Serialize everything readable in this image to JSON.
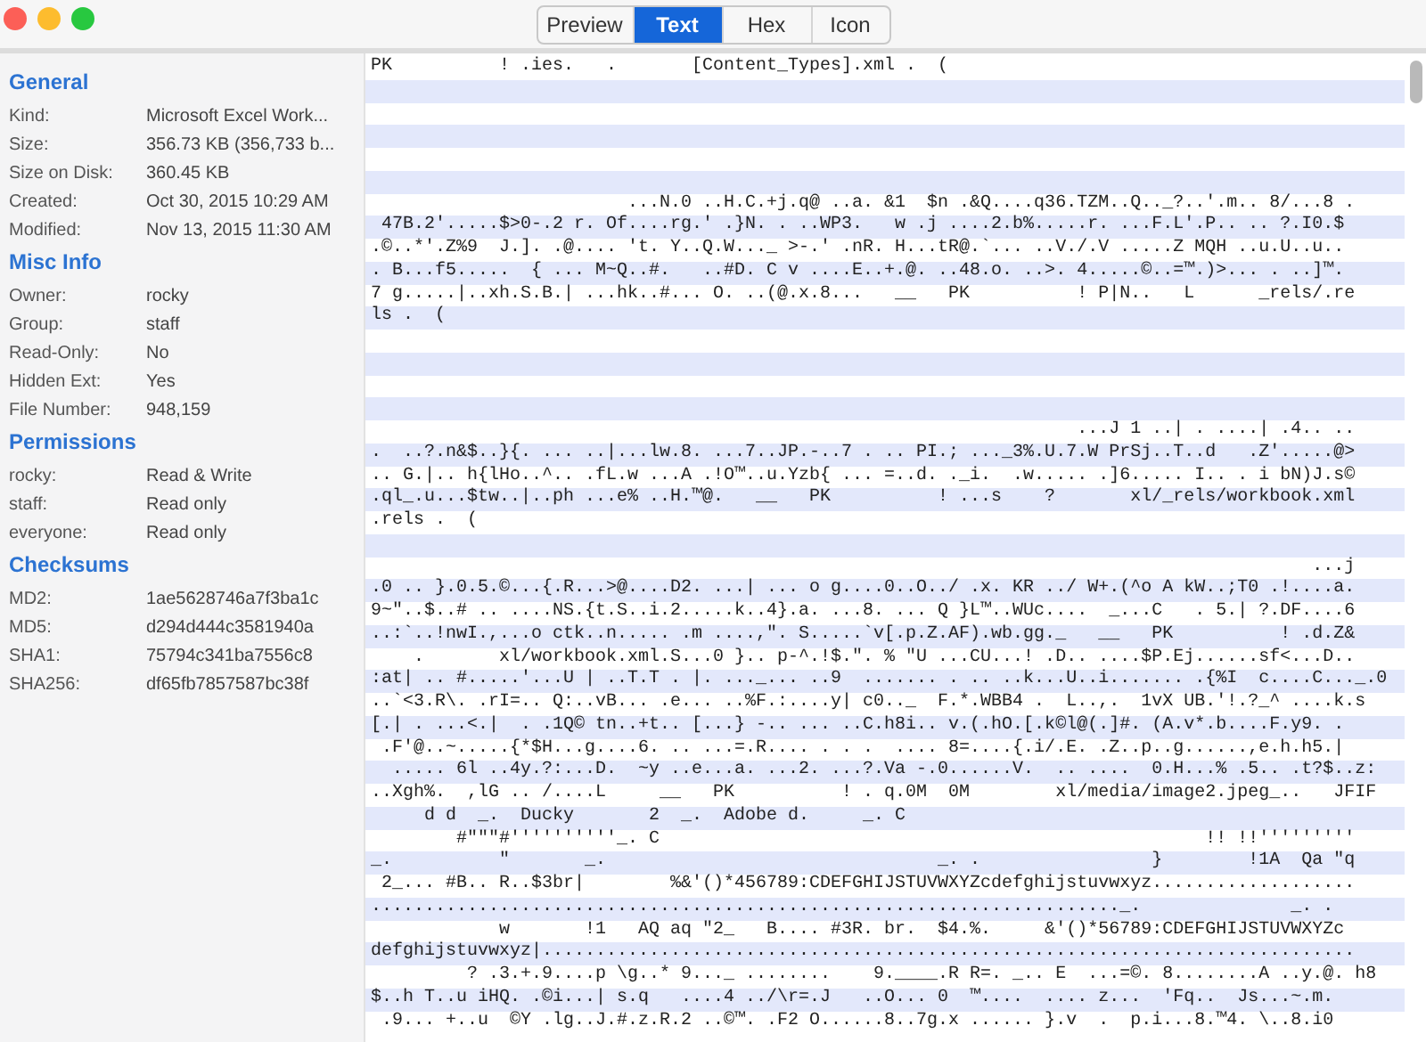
{
  "window": {
    "tabs": [
      {
        "label": "Preview",
        "selected": false
      },
      {
        "label": "Text",
        "selected": true
      },
      {
        "label": "Hex",
        "selected": false
      },
      {
        "label": "Icon",
        "selected": false
      }
    ]
  },
  "sidebar": {
    "sections": [
      {
        "title": "General",
        "rows": [
          {
            "label": "Kind:",
            "value": "Microsoft Excel Work..."
          },
          {
            "label": "Size:",
            "value": "356.73 KB (356,733 b..."
          },
          {
            "label": "Size on Disk:",
            "value": "360.45 KB"
          },
          {
            "label": "Created:",
            "value": "Oct 30, 2015 10:29 AM"
          },
          {
            "label": "Modified:",
            "value": "Nov 13, 2015 11:30 AM"
          }
        ]
      },
      {
        "title": "Misc Info",
        "rows": [
          {
            "label": "Owner:",
            "value": "rocky"
          },
          {
            "label": "Group:",
            "value": "staff"
          },
          {
            "label": "Read-Only:",
            "value": "No"
          },
          {
            "label": "Hidden Ext:",
            "value": "Yes"
          },
          {
            "label": "File Number:",
            "value": "948,159"
          }
        ]
      },
      {
        "title": "Permissions",
        "rows": [
          {
            "label": "rocky:",
            "value": "Read & Write"
          },
          {
            "label": "staff:",
            "value": "Read only"
          },
          {
            "label": "everyone:",
            "value": "Read only"
          }
        ]
      },
      {
        "title": "Checksums",
        "rows": [
          {
            "label": "MD2:",
            "value": "1ae5628746a7f3ba1c"
          },
          {
            "label": "MD5:",
            "value": "d294d444c3581940a"
          },
          {
            "label": "SHA1:",
            "value": "75794c341ba7556c8"
          },
          {
            "label": "SHA256:",
            "value": "df65fb7857587bc38f"
          }
        ]
      }
    ]
  },
  "text_view": {
    "lines": [
      {
        "kind": "text",
        "text": "PK          ! .ies.   .       [Content_Types].xml .  ("
      },
      {
        "kind": "blank"
      },
      {
        "kind": "blank"
      },
      {
        "kind": "blank"
      },
      {
        "kind": "blank"
      },
      {
        "kind": "blank"
      },
      {
        "kind": "text",
        "text": "                        ...N.0 ..H.C.+j.q@ ..a. &1  $n .&Q....q36.TZM..Q.._?..'.m.. 8/...8 ."
      },
      {
        "kind": "text",
        "text": " 47B.2'.....$>0-.2 r. Of....rg.' .}N. . ..WP3.   w .j ....2.b%.....r. ...F.L'.P.. .. ?.I0.$"
      },
      {
        "kind": "text",
        "text": ".©..*'.Z%9  J.]. .@.... 't. Y..Q.W..._ >-.' .nR. H...tR@.`... ..V./.V .....Z MQH ..u.U..u.."
      },
      {
        "kind": "text",
        "text": ". B...f5.....  { ... M~Q..#.   ..#D. C v ....E..+.@. ..48.o. ..>. 4.....©..=™.)>... . ..]™."
      },
      {
        "kind": "text",
        "text": "7 g.....|..xh.S.B.| ...hk..#... O. ..(@.x.8...   __   PK          ! P|N..   L      _rels/.re"
      },
      {
        "kind": "text",
        "text": "ls .  ("
      },
      {
        "kind": "blank"
      },
      {
        "kind": "blank"
      },
      {
        "kind": "blank"
      },
      {
        "kind": "blank"
      },
      {
        "kind": "text",
        "text": "                                                                  ...J 1 ..| . ....| .4.. .."
      },
      {
        "kind": "text",
        "text": ".  ..?.n&$..}{. ... ..|...lw.8. ...7..JP.-..7 . .. PI.; ..._3%.U.7.W PrSj..T..d   .Z'.....@>"
      },
      {
        "kind": "text",
        "text": ".. G.|.. h{lHo..^.. .fL.w ...A .!O™..u.Yzb{ ... =..d. ._i.  .w..... .]6..... I.. . i bN)J.s©"
      },
      {
        "kind": "text",
        "text": ".ql_.u...$tw..|..ph ...e% ..H.™@.   __   PK          ! ...s    ?       xl/_rels/workbook.xml"
      },
      {
        "kind": "text",
        "text": ".rels .  ("
      },
      {
        "kind": "blank"
      },
      {
        "kind": "text",
        "text": "                                                                                        ...j"
      },
      {
        "kind": "text",
        "text": ".0 .. }.0.5.©...{.R...>@....D2. ...| ... o g....0..O../ .x. KR ../ W+.(^o A kW..;T0 .!....a."
      },
      {
        "kind": "text",
        "text": "9~\"..$..# .. ....NS.{t.S..i.2.....k..4}.a. ...8. ... Q }L™..WUc....  _...C   . 5.| ?.DF....6"
      },
      {
        "kind": "text",
        "text": "..:`..!nwI.,...o ctk..n..... .m ....,\". S.....`v[.p.Z.AF).wb.gg._   __   PK          ! .d.Z&"
      },
      {
        "kind": "text",
        "text": "    .       xl/workbook.xml.S...0 }.. p-^.!$.\". % \"U ...CU...! .D.. ....$P.Ej......sf<...D.."
      },
      {
        "kind": "text",
        "text": ":at| .. #.....'...U | ..T.T . |. ..._... ..9  ....... . .. ..k...U..i....... .{%I  c....C..._.0"
      },
      {
        "kind": "text",
        "text": "..`<3.R\\. .rI=.. Q:..vB... .e... ..%F.:....y| c0.._  F.*.WBB4 .  L..,.  1vX UB.'!.?_^ ....k.s"
      },
      {
        "kind": "text",
        "text": "[.| . ...<.|  . .1Q© tn..+t.. [...} -.. ... ..C.h8i.. v.(.hO.[.k©l@(.]#. (A.v*.b....F.y9. ."
      },
      {
        "kind": "text",
        "text": " .F'@..~.....{*$H...g....6. .. ...=.R.... . . .  .... 8=....{.i/.E. .Z..p..g......,e.h.h5.|"
      },
      {
        "kind": "text",
        "text": "  ..... 6l ..4y.?:...D.  ~y ..e...a. ...2. ...?.Va -.0......V.  .. ....  0.H...% .5.. .t?$..z:"
      },
      {
        "kind": "text",
        "text": "..Xgh%.  ,lG .. /....L     __   PK          ! . q.0M  0M        xl/media/image2.jpeg_..   JFIF"
      },
      {
        "kind": "text",
        "text": "     d d  _.  Ducky       2  _.  Adobe d.     _. C"
      },
      {
        "kind": "text",
        "text": "        #\"\"\"#''''''''''_. C                                                   !! !!'''''''''"
      },
      {
        "kind": "text",
        "text": "_.          \"       _.                               _. .                }        !1A  Qa \"q"
      },
      {
        "kind": "text",
        "text": " 2_... #B.. R..$3br|        %&'()*456789:CDEFGHIJSTUVWXYZcdefghijstuvwxyz..................."
      },
      {
        "kind": "text",
        "text": "......................................................................_.              _. ."
      },
      {
        "kind": "text",
        "text": "            w       !1   AQ aq \"2_   B.... #3R. br.  $4.%.     &'()*56789:CDEFGHIJSTUVWXYZc"
      },
      {
        "kind": "text",
        "text": "defghijstuvwxyz|............................................................................"
      },
      {
        "kind": "text",
        "text": "         ? .3.+.9....p \\g..* 9..._ ........    9.____.R R=. _.. E  ...=©. 8........A ..y.@. h8"
      },
      {
        "kind": "text",
        "text": "$..h T..u iHQ. .©i...| s.q   ....4 ../\\r=.J   ..O... 0  ™....  .... z...  'Fq..  Js...~.m."
      },
      {
        "kind": "text",
        "text": " .9... +..u  ©Y .lg..J.#.z.R.2 ..©™. .F2 O......8..7g.x ...... }.v  .  p.i...8.™4. \\..8.i0"
      }
    ]
  }
}
